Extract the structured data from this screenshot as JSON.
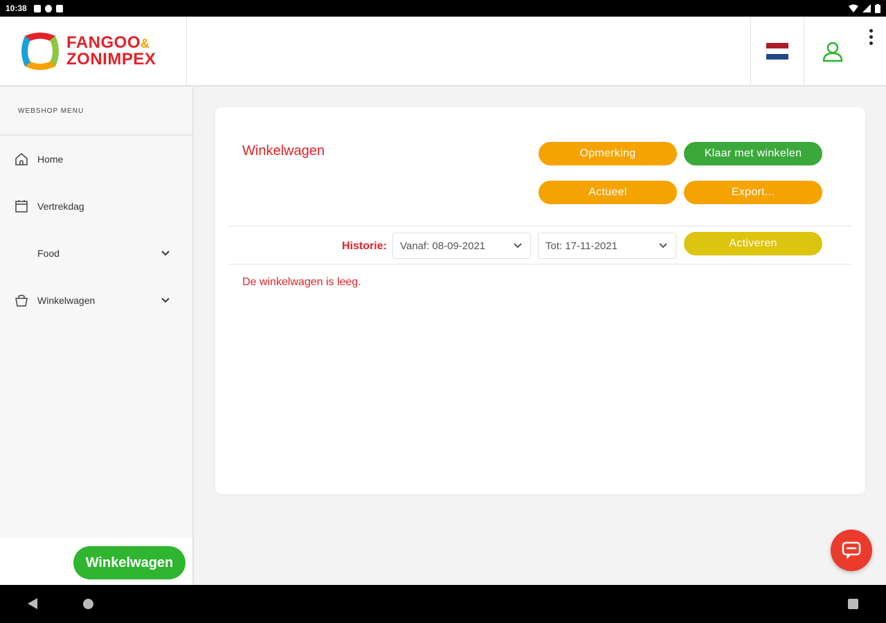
{
  "statusbar": {
    "time": "10:38"
  },
  "brand": {
    "line1": "FANGOO",
    "amp": "&",
    "line2": "ZONIMPEX"
  },
  "header": {
    "flag_colors": [
      "#ae1c28",
      "#ffffff",
      "#21468b"
    ],
    "user_icon_color": "#2fb52f"
  },
  "sidebar": {
    "title": "WEBSHOP MENU",
    "items": [
      {
        "label": "Home",
        "icon": "home-icon"
      },
      {
        "label": "Vertrekdag",
        "icon": "calendar-icon"
      },
      {
        "label": "Food",
        "icon": ""
      },
      {
        "label": "Winkelwagen",
        "icon": "basket-icon"
      }
    ],
    "cart_button": "Winkelwagen"
  },
  "main": {
    "title": "Winkelwagen",
    "buttons": {
      "opmerking": "Opmerking",
      "klaar": "Klaar met winkelen",
      "actueel": "Actueel",
      "export": "Export...",
      "activeren": "Activeren"
    },
    "history": {
      "label": "Historie:",
      "from": "Vanaf: 08-09-2021",
      "to": "Tot: 17-11-2021"
    },
    "empty_message": "De winkelwagen is leeg."
  },
  "colors": {
    "brand_red": "#e32229",
    "orange": "#f5a300",
    "green": "#3aa83a",
    "yellow": "#ddc40e",
    "chat": "#ea3b2d"
  }
}
